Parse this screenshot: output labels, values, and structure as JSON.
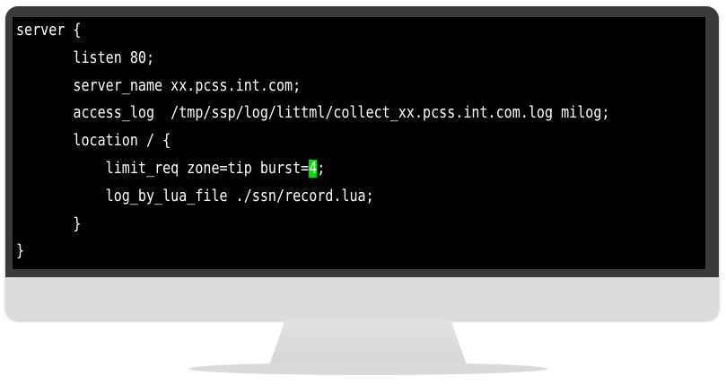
{
  "terminal": {
    "lines": {
      "l1": "server {",
      "l2": "       listen 80;",
      "l3": "       server_name xx.pcss.int.com;",
      "l4": "       access_log  /tmp/ssp/log/littml/collect_xx.pcss.int.com.log milog;",
      "l5": "       location / {",
      "l6_before": "           limit_req zone=tip burst=",
      "l6_highlight": "4",
      "l6_after": ";",
      "l7": "           log_by_lua_file ./ssn/record.lua;",
      "l8": "       }",
      "l9": "}"
    },
    "highlight_color": "#00dd00",
    "background_color": "#000000",
    "text_color": "#ffffff"
  },
  "monitor": {
    "frame_color": "#3a3a3a",
    "chin_color": "#dcdcdc"
  }
}
